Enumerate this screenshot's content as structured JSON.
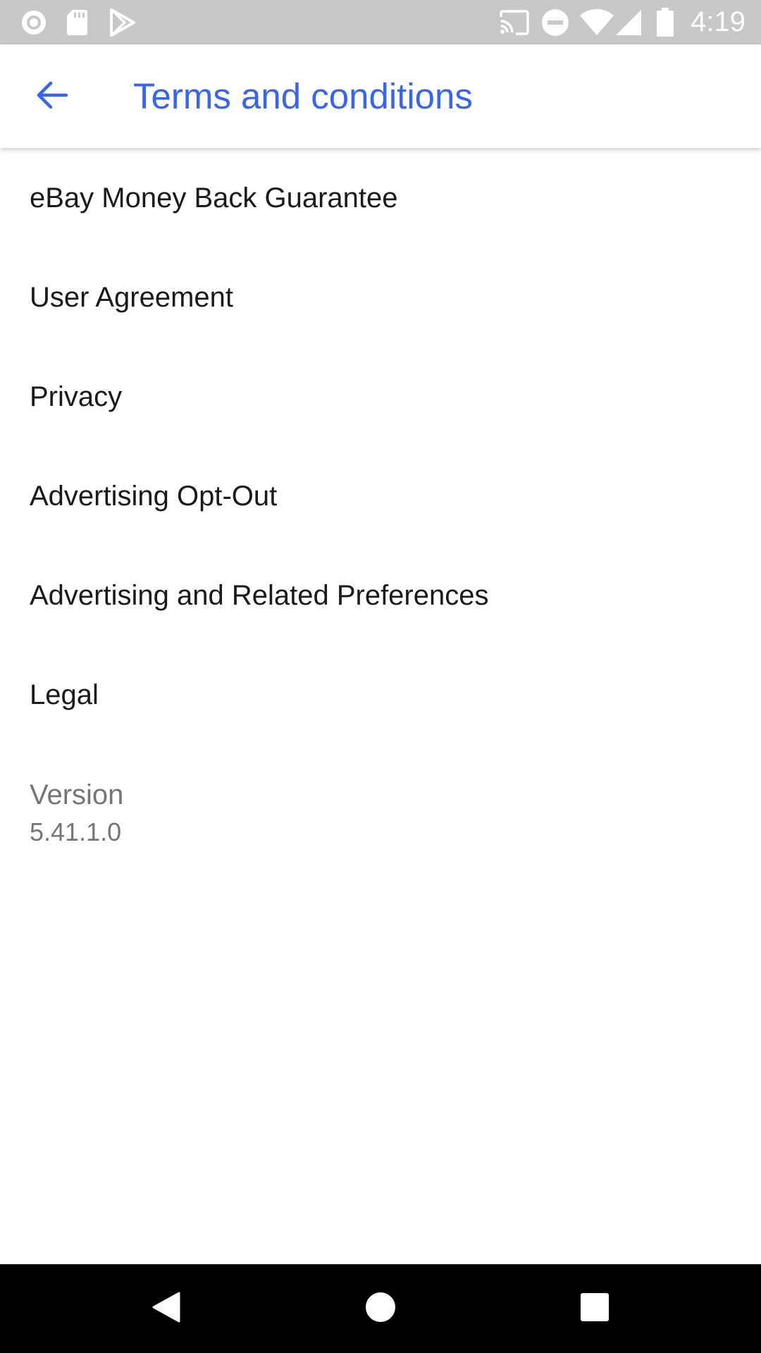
{
  "status_bar": {
    "time": "4:19",
    "icons": [
      "circle-notification-icon",
      "sd-card-icon",
      "play-store-icon",
      "cast-icon",
      "do-not-disturb-icon",
      "wifi-icon",
      "signal-icon",
      "battery-icon"
    ]
  },
  "app_bar": {
    "title": "Terms and conditions",
    "back_icon": "arrow-back-icon",
    "accent_color": "#3665f3"
  },
  "menu": {
    "items": [
      {
        "label": "eBay Money Back Guarantee"
      },
      {
        "label": "User Agreement"
      },
      {
        "label": "Privacy"
      },
      {
        "label": "Advertising Opt-Out"
      },
      {
        "label": "Advertising and Related Preferences"
      },
      {
        "label": "Legal"
      }
    ]
  },
  "version": {
    "label": "Version",
    "value": "5.41.1.0"
  },
  "nav_bar": {
    "icons": [
      "nav-back-icon",
      "nav-home-icon",
      "nav-recents-icon"
    ]
  }
}
